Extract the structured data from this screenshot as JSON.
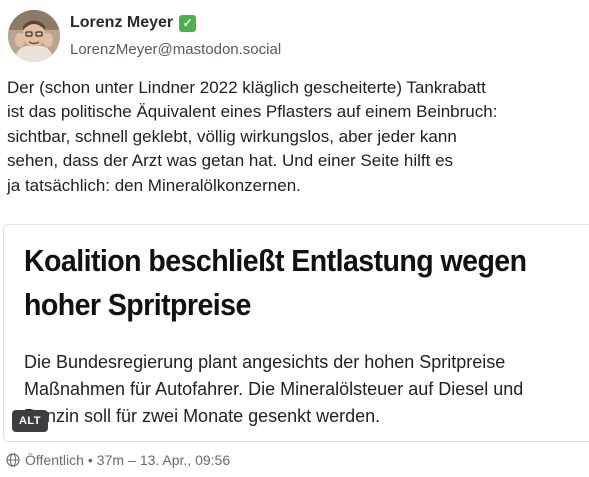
{
  "author": {
    "name": "Lorenz Meyer",
    "verified_mark": "✓",
    "handle": "LorenzMeyer@mastodon.social",
    "avatar_icon": "avatar-photo"
  },
  "post": {
    "lines": [
      "Der (schon unter Lindner 2022 kläglich gescheiterte) Tankrabatt",
      "ist das politische Äquivalent eines Pflasters auf einem Beinbruch:",
      "sichtbar, schnell geklebt, völlig wirkungslos,  aber jeder kann",
      "sehen, dass der Arzt was getan hat. Und einer Seite hilft es",
      "ja tatsächlich: den Mineralölkonzernen."
    ]
  },
  "card": {
    "headline": [
      "Koalition beschließt Entlastung wegen",
      "hoher Spritpreise"
    ],
    "body": [
      "Die Bundesregierung plant angesichts der hohen Spritpreise",
      "Maßnahmen für Autofahrer. Die Mineralölsteuer auf Diesel und",
      "Benzin soll für zwei Monate gesenkt werden."
    ],
    "alt_label": "ALT"
  },
  "meta": {
    "icon": "globe-icon",
    "visibility": "Öffentlich",
    "separator": "•",
    "relative_time": "37m",
    "dash": "–",
    "date": "13. Apr., 09:56"
  },
  "colors": {
    "verified": "#4caf50",
    "alt_badge": "#3b3d42",
    "meta_text": "#666b70"
  }
}
